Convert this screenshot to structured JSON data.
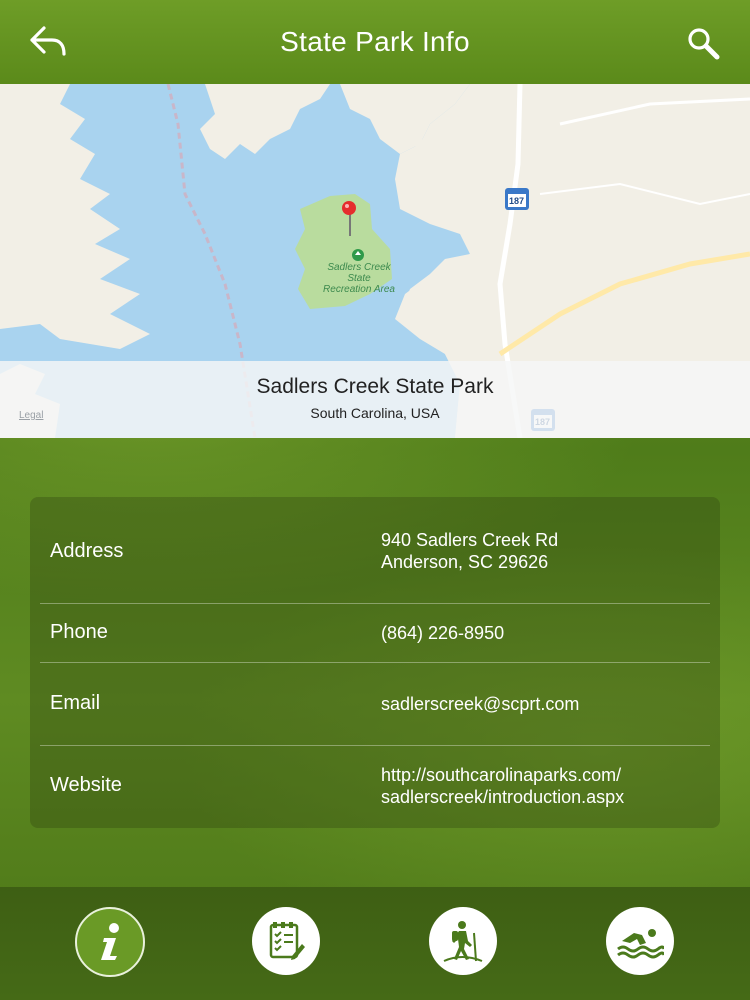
{
  "header": {
    "title": "State Park Info",
    "back_icon": "back-arrow-icon",
    "search_icon": "search-icon"
  },
  "map": {
    "park_name": "Sadlers Creek State Park",
    "location": "South Carolina, USA",
    "area_label_line1": "Sadlers Creek",
    "area_label_line2": "State",
    "area_label_line3": "Recreation Area",
    "route_number": "187",
    "legal": "Legal"
  },
  "info": {
    "rows": [
      {
        "label": "Address",
        "value_line1": "940 Sadlers Creek Rd",
        "value_line2": "Anderson, SC 29626"
      },
      {
        "label": "Phone",
        "value_line1": "(864) 226-8950"
      },
      {
        "label": "Email",
        "value_line1": "sadlerscreek@scprt.com"
      },
      {
        "label": "Website",
        "value_line1": "http://southcarolinaparks.com/",
        "value_line2": "sadlerscreek/introduction.aspx"
      }
    ]
  },
  "tabs": [
    {
      "icon": "info-icon",
      "active": true
    },
    {
      "icon": "checklist-icon",
      "active": false
    },
    {
      "icon": "hiker-icon",
      "active": false
    },
    {
      "icon": "swimmer-icon",
      "active": false
    }
  ],
  "colors": {
    "header_green": "#6e9d27",
    "water": "#a9d3ef",
    "park_green": "#b9dc9e"
  }
}
